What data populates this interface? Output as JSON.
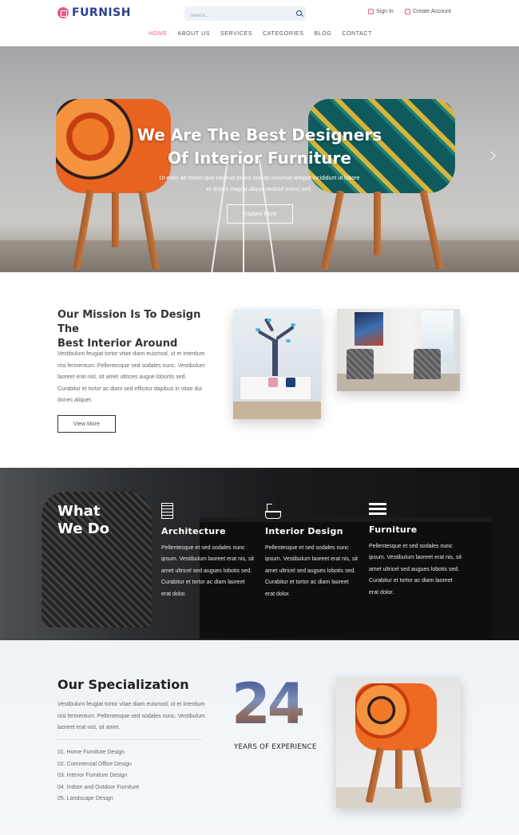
{
  "header": {
    "logo_text": "FURNISH",
    "search_placeholder": "Search...",
    "signin_label": "Sign In",
    "create_account_label": "Create Account"
  },
  "nav": {
    "items": [
      "HOME",
      "ABOUT US",
      "SERVICES",
      "CATEGORIES",
      "BLOG",
      "CONTACT"
    ],
    "active": "HOME"
  },
  "hero": {
    "title_line1": "We Are The Best Designers",
    "title_line2": "Of Interior Furniture",
    "subtitle_line1": "Ut enim ad minim quis nostrud exerci sed do eiusmod tempor incididunt ut labore",
    "subtitle_line2": "et dolore magna aliqua nostrud exerci sed.",
    "button_label": "Explore More"
  },
  "mission": {
    "title_line1": "Our Mission Is To Design The",
    "title_line2": "Best Interior Around",
    "text": "Vestibulum feugiat tortor vitae diam euismod, ut et interdum nisi fermentum. Pellentesque sed sodales nunc. Vestibulum laoreet erat nisl, sit amet ultrices augue lobortis sed. Curabitur et tortor ac diam sed efficitur dapibus in vitae dui donec aliquet.",
    "button_label": "View More"
  },
  "what_we_do": {
    "title_line1": "What",
    "title_line2": "We Do",
    "services": [
      {
        "icon": "building-icon",
        "title": "Architecture",
        "text": "Pellentesque et sed sodales nunc ipsum. Vestibulum laoreet erat nis, sit amet ultricel sed augues lobotis sed. Curabitur et tortor ac diam laoreet erat dolor."
      },
      {
        "icon": "bathtub-icon",
        "title": "Interior Design",
        "text": "Pellentesque et sed sodales nunc ipsum. Vestibulum laoreet erat nis, sit amet ultricel sed augues lobotis sed. Curabitur et tortor ac diam laoreet erat dolor."
      },
      {
        "icon": "list-icon",
        "title": "Furniture",
        "text": "Pellentesque et sed sodales nunc ipsum. Vestibulum laoreet erat nis, sit amet ultricel sed augues lobotis sed. Curabitur et tortor ac diam laoreet erat dolor."
      }
    ]
  },
  "specialization": {
    "title": "Our Specialization",
    "text": "Vestibulum feugiat tortor vitae diam euismod, ut et interdum nisi fermentum. Pellentesque sed sodales nunc. Vestibulum laoreet erat nisl, sit amet.",
    "list": [
      "01. Home Furniture Design",
      "02. Commercial Office Design",
      "03. Interior Furniture Design",
      "04. Indoor and Outdoor Furniture",
      "05. Landscape Design"
    ],
    "years_number": "24",
    "years_label": "YEARS OF EXPERIENCE"
  },
  "colors": {
    "brand": "#2d3e8c",
    "accent": "#e85a8c"
  }
}
